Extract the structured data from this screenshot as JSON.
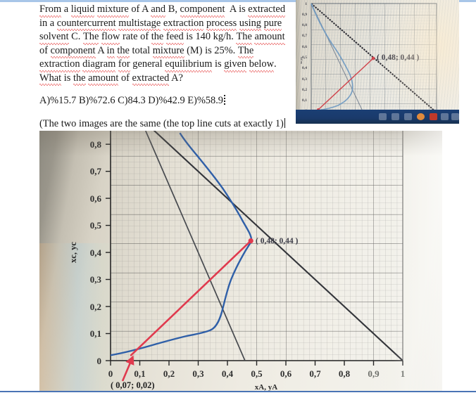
{
  "document": {
    "question_lines": [
      "From a liquid mixture of A and B, component  A is extracted",
      "in a countercurrent multistage extraction process using pure",
      "solvent C. The  flow rate of the feed is 140 kg/h. The amount",
      "of component A in the total mixture (M) is 25%. The",
      "extraction diagram for general equilibrium is given below.",
      "What is the amount of extracted A?"
    ],
    "answer_choices_line": "A)%15.7 B)%72.6 C)84.3 D)%42.9 E)%58.9",
    "note_line": "(The two images are the same (the top line cuts at exactly 1)"
  },
  "chart_data": {
    "type": "scatter",
    "title": "",
    "xlabel": "xA, yA",
    "ylabel": "xc, yc",
    "xlim": [
      0,
      1
    ],
    "ylim": [
      0,
      0.85
    ],
    "grid": true,
    "xticks": [
      "0",
      "0,1",
      "0,2",
      "0,3",
      "0,4",
      "0,5",
      "0,6",
      "0,7",
      "0,8",
      "0,9",
      "1"
    ],
    "xtick_values": [
      0,
      0.1,
      0.2,
      0.3,
      0.4,
      0.5,
      0.6,
      0.7,
      0.8,
      0.9,
      1
    ],
    "yticks": [
      "0",
      "0,1",
      "0,2",
      "0,3",
      "0,4",
      "0,5",
      "0,6",
      "0,7",
      "0,8"
    ],
    "ytick_values": [
      0,
      0.1,
      0.2,
      0.3,
      0.4,
      0.5,
      0.6,
      0.7,
      0.8
    ],
    "annotations": [
      {
        "label": "( 0,48; 0,44  )",
        "x": 0.48,
        "y": 0.44,
        "color": "#e03a4e"
      },
      {
        "label": "( 0,07; 0,02)",
        "x": 0.07,
        "y": 0.02,
        "color": "#e03a4e"
      }
    ],
    "series": [
      {
        "name": "binodal-curve",
        "color": "#2f5fa8",
        "type": "line",
        "points": [
          [
            0.0,
            0.02
          ],
          [
            0.04,
            0.028
          ],
          [
            0.08,
            0.038
          ],
          [
            0.12,
            0.05
          ],
          [
            0.16,
            0.062
          ],
          [
            0.2,
            0.075
          ],
          [
            0.24,
            0.086
          ],
          [
            0.26,
            0.093
          ],
          [
            0.28,
            0.092
          ],
          [
            0.31,
            0.098
          ],
          [
            0.34,
            0.112
          ],
          [
            0.36,
            0.135
          ],
          [
            0.375,
            0.165
          ],
          [
            0.385,
            0.2
          ],
          [
            0.4,
            0.25
          ],
          [
            0.415,
            0.3
          ],
          [
            0.435,
            0.35
          ],
          [
            0.455,
            0.395
          ],
          [
            0.47,
            0.425
          ],
          [
            0.48,
            0.443
          ],
          [
            0.465,
            0.47
          ],
          [
            0.445,
            0.505
          ],
          [
            0.425,
            0.545
          ],
          [
            0.405,
            0.585
          ],
          [
            0.385,
            0.625
          ],
          [
            0.355,
            0.665
          ],
          [
            0.325,
            0.705
          ],
          [
            0.285,
            0.75
          ],
          [
            0.245,
            0.795
          ],
          [
            0.205,
            0.84
          ]
        ]
      },
      {
        "name": "total-balance-line",
        "color": "#3b3b3b",
        "type": "line",
        "points": [
          [
            0.0,
            1.0
          ],
          [
            1.0,
            0.0
          ]
        ]
      },
      {
        "name": "operating-line",
        "color": "#3b3b3b",
        "type": "line",
        "points": [
          [
            0.12,
            0.85
          ],
          [
            0.46,
            0.0
          ]
        ]
      },
      {
        "name": "tie-line",
        "color": "#e03a4e",
        "type": "line",
        "points": [
          [
            0.07,
            0.02
          ],
          [
            0.48,
            0.443
          ]
        ]
      }
    ]
  },
  "thumbnail": {
    "caption": "( 0,48; 0,44 )",
    "yticks": [
      "1",
      "0,9",
      "0,8",
      "0,7",
      "0,6",
      "0,5",
      "0,4",
      "0,3",
      "0,2",
      "0,1",
      "0"
    ],
    "ylabel": "xc,yc"
  }
}
